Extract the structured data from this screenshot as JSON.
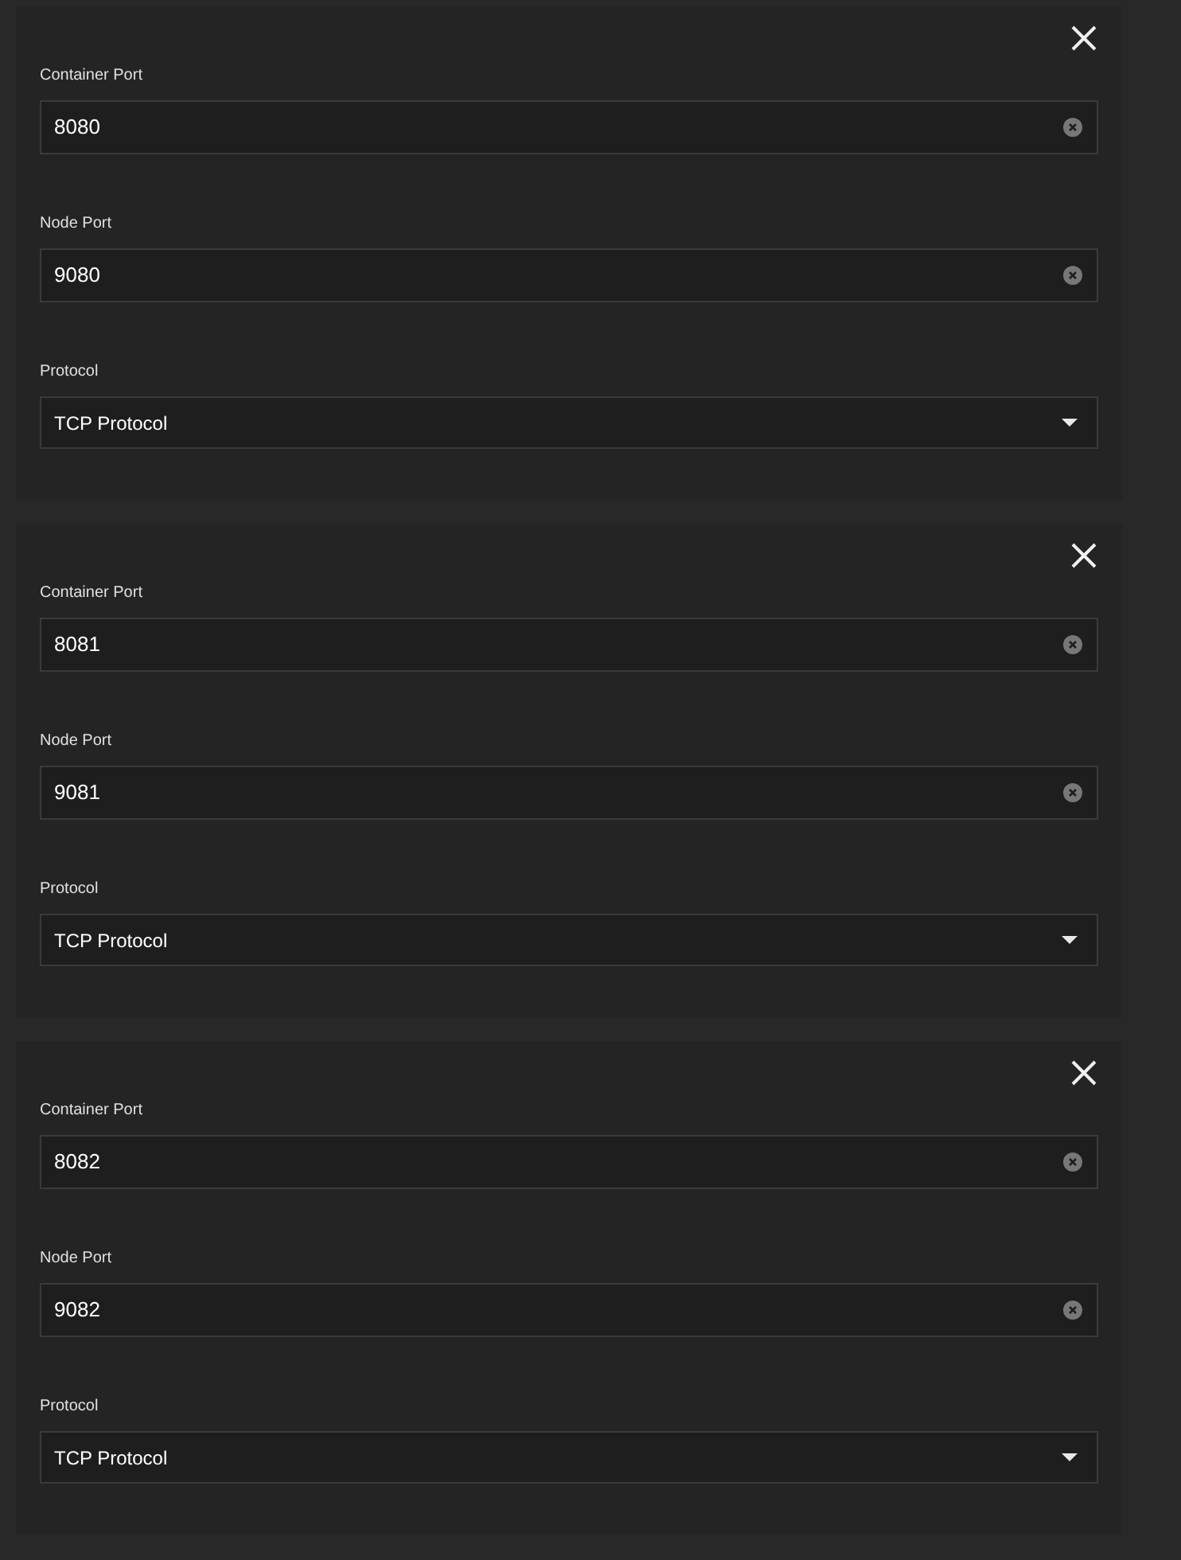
{
  "port_mappings": [
    {
      "fields": [
        {
          "kind": "text",
          "label": "Container Port",
          "value": "8080"
        },
        {
          "kind": "text",
          "label": "Node Port",
          "value": "9080"
        },
        {
          "kind": "select",
          "label": "Protocol",
          "value": "TCP Protocol"
        }
      ]
    },
    {
      "fields": [
        {
          "kind": "text",
          "label": "Container Port",
          "value": "8081"
        },
        {
          "kind": "text",
          "label": "Node Port",
          "value": "9081"
        },
        {
          "kind": "select",
          "label": "Protocol",
          "value": "TCP Protocol"
        }
      ]
    },
    {
      "fields": [
        {
          "kind": "text",
          "label": "Container Port",
          "value": "8082"
        },
        {
          "kind": "text",
          "label": "Node Port",
          "value": "9082"
        },
        {
          "kind": "select",
          "label": "Protocol",
          "value": "TCP Protocol"
        }
      ]
    }
  ]
}
